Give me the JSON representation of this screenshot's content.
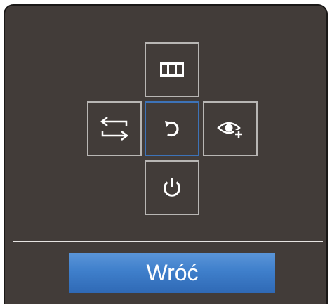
{
  "panel": {
    "background_color": "#423c39",
    "border_color": "#1a1817"
  },
  "joystick": {
    "buttons": [
      {
        "id": "menu",
        "icon": "menu-grid-icon",
        "selected": false
      },
      {
        "id": "source",
        "icon": "source-arrows-icon",
        "selected": false
      },
      {
        "id": "return",
        "icon": "return-arrow-icon",
        "selected": true
      },
      {
        "id": "eye_saver",
        "icon": "eye-plus-icon",
        "selected": false
      },
      {
        "id": "power",
        "icon": "power-icon",
        "selected": false
      }
    ],
    "border_color": "#b8b6b4",
    "selected_border_color": "#3d73b8"
  },
  "footer": {
    "back_label": "Wróć",
    "back_button_color": "#3f7fcb"
  }
}
